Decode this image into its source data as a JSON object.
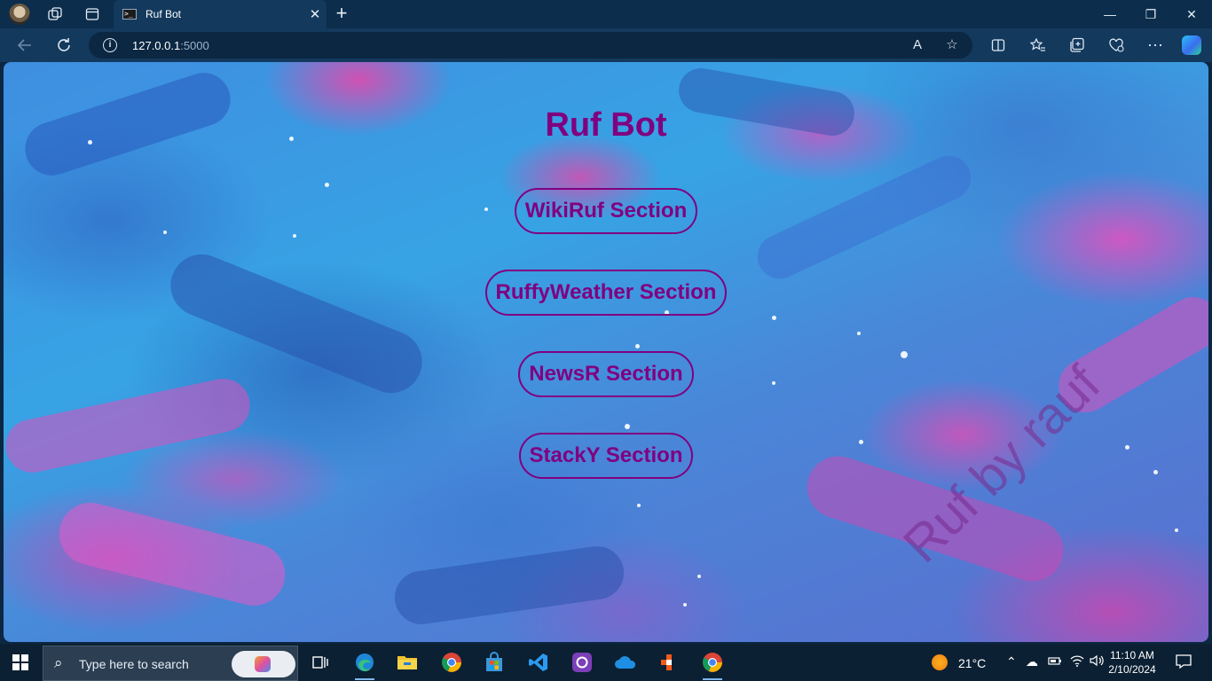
{
  "browser": {
    "tab": {
      "title": "Ruf Bot",
      "close": "✕"
    },
    "new_tab": "+",
    "address": {
      "host": "127.0.0.1",
      "port": ":5000"
    },
    "window_controls": {
      "minimize": "—",
      "restore": "❐",
      "close": "✕"
    }
  },
  "page": {
    "title": "Ruf Bot",
    "sections": [
      {
        "label": "WikiRuf Section"
      },
      {
        "label": "RuffyWeather Section"
      },
      {
        "label": "NewsR Section"
      },
      {
        "label": "StackY Section"
      }
    ],
    "watermark": "Ruf by rauf",
    "colors": {
      "accent": "#800080"
    }
  },
  "taskbar": {
    "search_placeholder": "Type here to search",
    "weather": {
      "temp": "21°C"
    },
    "clock": {
      "time": "11:10 AM",
      "date": "2/10/2024"
    },
    "apps": [
      "task-view",
      "edge",
      "file-explorer",
      "chrome",
      "microsoft-store",
      "vscode",
      "github-desktop",
      "onedrive",
      "app",
      "chrome"
    ]
  }
}
